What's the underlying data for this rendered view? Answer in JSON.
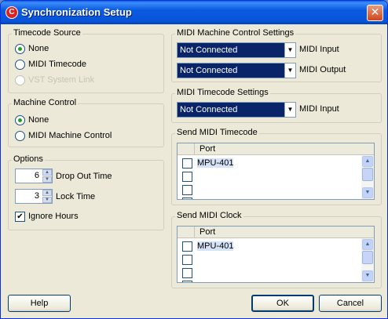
{
  "window": {
    "title": "Synchronization Setup",
    "app_icon_glyph": "C"
  },
  "timecode_source": {
    "title": "Timecode Source",
    "options": [
      {
        "label": "None",
        "checked": true,
        "disabled": false
      },
      {
        "label": "MIDI Timecode",
        "checked": false,
        "disabled": false
      },
      {
        "label": "VST System Link",
        "checked": false,
        "disabled": true
      }
    ]
  },
  "machine_control": {
    "title": "Machine Control",
    "options": [
      {
        "label": "None",
        "checked": true
      },
      {
        "label": "MIDI Machine Control",
        "checked": false
      }
    ]
  },
  "options": {
    "title": "Options",
    "drop_out_time": {
      "value": "6",
      "label": "Drop Out Time"
    },
    "lock_time": {
      "value": "3",
      "label": "Lock Time"
    },
    "ignore_hours": {
      "label": "Ignore Hours",
      "checked": true,
      "mark": "✔"
    }
  },
  "mmc_settings": {
    "title": "MIDI Machine Control Settings",
    "input": {
      "value": "Not Connected",
      "label": "MIDI Input"
    },
    "output": {
      "value": "Not Connected",
      "label": "MIDI Output"
    }
  },
  "mtc_settings": {
    "title": "MIDI Timecode Settings",
    "input": {
      "value": "Not Connected",
      "label": "MIDI Input"
    }
  },
  "send_mtc": {
    "title": "Send MIDI Timecode",
    "column": "Port",
    "rows": [
      "MPU-401",
      "",
      "",
      ""
    ]
  },
  "send_clock": {
    "title": "Send MIDI Clock",
    "column": "Port",
    "rows": [
      "MPU-401",
      "",
      "",
      ""
    ]
  },
  "buttons": {
    "help": "Help",
    "ok": "OK",
    "cancel": "Cancel"
  },
  "icons": {
    "arrow_down": "▼",
    "arrow_up": "▲",
    "close": "✕"
  },
  "colors": {
    "title_bar": "#0a5ae0",
    "combo_bg": "#0a246a",
    "radio_dot": "#21a121",
    "window_bg": "#ece9d8"
  }
}
